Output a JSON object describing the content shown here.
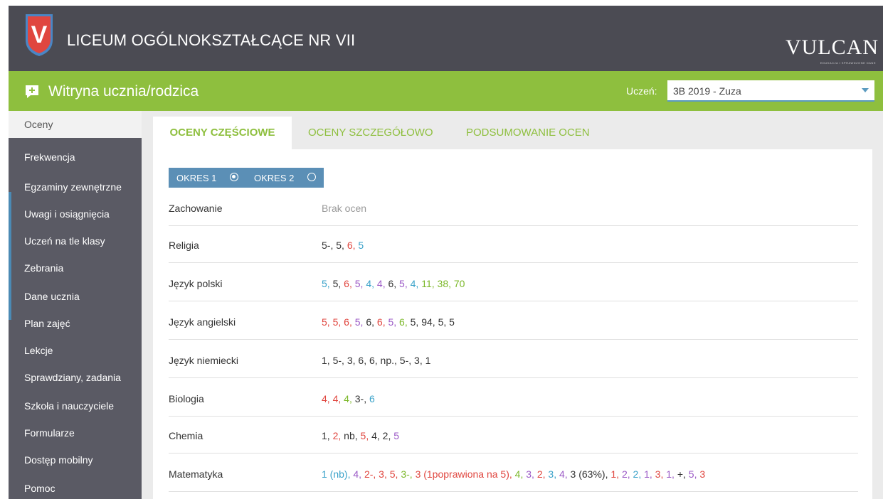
{
  "header": {
    "school_name": "LICEUM OGÓLNOKSZTAŁCĄCE NR VII",
    "brand": "VULCAN",
    "brand_sub": "EDUKACJA I SPRAWDZONE DANE",
    "logo_letter": "V",
    "colors": {
      "topbar": "#4b4b53",
      "greenbar": "#8ebf3e",
      "shield": "#e0463f",
      "accent": "#5b8fb6"
    }
  },
  "portal": {
    "title": "Witryna ucznia/rodzica",
    "icon": "chat-plus-icon",
    "student_label": "Uczeń:",
    "student_value": "3B  2019 - Zuza"
  },
  "sidebar": {
    "items": [
      {
        "label": "Oceny",
        "active": true
      },
      {
        "label": "Frekwencja"
      },
      {
        "label": "Egzaminy zewnętrzne"
      },
      {
        "label": "Uwagi i osiągnięcia"
      },
      {
        "label": "Uczeń na tle klasy"
      },
      {
        "label": "Zebrania"
      },
      {
        "label": "Dane ucznia"
      },
      {
        "label": "Plan zajęć"
      },
      {
        "label": "Lekcje"
      },
      {
        "label": "Sprawdziany, zadania"
      },
      {
        "label": "Szkoła i nauczyciele"
      },
      {
        "label": "Formularze"
      },
      {
        "label": "Dostęp mobilny"
      },
      {
        "label": "Pomoc"
      }
    ]
  },
  "tabs": [
    {
      "label": "OCENY CZĘŚCIOWE",
      "active": true
    },
    {
      "label": "OCENY SZCZEGÓŁOWO"
    },
    {
      "label": "PODSUMOWANIE OCEN"
    }
  ],
  "periods": [
    {
      "label": "OKRES 1",
      "selected": true
    },
    {
      "label": "OKRES 2",
      "selected": false
    }
  ],
  "subjects": [
    {
      "name": "Zachowanie",
      "grades": [
        {
          "v": "Brak ocen",
          "c": "gray"
        }
      ]
    },
    {
      "name": "Religia",
      "grades": [
        {
          "v": "5-",
          "c": "black"
        },
        {
          "v": "5",
          "c": "black"
        },
        {
          "v": "6",
          "c": "red"
        },
        {
          "v": "5",
          "c": "blue"
        }
      ]
    },
    {
      "name": "Język polski",
      "grades": [
        {
          "v": "5",
          "c": "blue"
        },
        {
          "v": "5",
          "c": "black"
        },
        {
          "v": "6",
          "c": "red"
        },
        {
          "v": "5",
          "c": "purple"
        },
        {
          "v": "4",
          "c": "blue"
        },
        {
          "v": "4",
          "c": "purple"
        },
        {
          "v": "6",
          "c": "black"
        },
        {
          "v": "5",
          "c": "purple"
        },
        {
          "v": "4",
          "c": "blue"
        },
        {
          "v": "11",
          "c": "green"
        },
        {
          "v": "38",
          "c": "green"
        },
        {
          "v": "70",
          "c": "green"
        }
      ]
    },
    {
      "name": "Język angielski",
      "grades": [
        {
          "v": "5",
          "c": "red"
        },
        {
          "v": "5",
          "c": "red"
        },
        {
          "v": "6",
          "c": "red"
        },
        {
          "v": "5",
          "c": "purple"
        },
        {
          "v": "6",
          "c": "black"
        },
        {
          "v": "6",
          "c": "red"
        },
        {
          "v": "5",
          "c": "purple"
        },
        {
          "v": "6",
          "c": "green"
        },
        {
          "v": "5",
          "c": "black"
        },
        {
          "v": "94",
          "c": "black"
        },
        {
          "v": "5",
          "c": "black"
        },
        {
          "v": "5",
          "c": "black"
        }
      ]
    },
    {
      "name": "Język niemiecki",
      "grades": [
        {
          "v": "1",
          "c": "black"
        },
        {
          "v": "5-",
          "c": "black"
        },
        {
          "v": "3",
          "c": "black"
        },
        {
          "v": "6",
          "c": "black"
        },
        {
          "v": "6",
          "c": "black"
        },
        {
          "v": "np.",
          "c": "black"
        },
        {
          "v": "5-",
          "c": "black"
        },
        {
          "v": "3",
          "c": "black"
        },
        {
          "v": "1",
          "c": "black"
        }
      ]
    },
    {
      "name": "Biologia",
      "grades": [
        {
          "v": "4",
          "c": "red"
        },
        {
          "v": "4",
          "c": "red"
        },
        {
          "v": "4",
          "c": "green"
        },
        {
          "v": "3-",
          "c": "black"
        },
        {
          "v": "6",
          "c": "blue"
        }
      ]
    },
    {
      "name": "Chemia",
      "grades": [
        {
          "v": "1",
          "c": "black"
        },
        {
          "v": "2",
          "c": "red"
        },
        {
          "v": "nb",
          "c": "black"
        },
        {
          "v": "5",
          "c": "red"
        },
        {
          "v": "4",
          "c": "black"
        },
        {
          "v": "2",
          "c": "black"
        },
        {
          "v": "5",
          "c": "purple"
        }
      ]
    },
    {
      "name": "Matematyka",
      "grades": [
        {
          "v": "1 (nb)",
          "c": "blue"
        },
        {
          "v": "4",
          "c": "purple"
        },
        {
          "v": "2-",
          "c": "red"
        },
        {
          "v": "3",
          "c": "red"
        },
        {
          "v": "5",
          "c": "red"
        },
        {
          "v": "3-",
          "c": "green"
        },
        {
          "v": "3 (1poprawiona na 5)",
          "c": "red"
        },
        {
          "v": "4",
          "c": "green"
        },
        {
          "v": "3",
          "c": "purple"
        },
        {
          "v": "2",
          "c": "red"
        },
        {
          "v": "3",
          "c": "blue"
        },
        {
          "v": "4",
          "c": "purple"
        },
        {
          "v": "3 (63%)",
          "c": "black"
        },
        {
          "v": "1",
          "c": "red"
        },
        {
          "v": "2",
          "c": "purple"
        },
        {
          "v": "2",
          "c": "blue"
        },
        {
          "v": "1",
          "c": "purple"
        },
        {
          "v": "3",
          "c": "red"
        },
        {
          "v": "1",
          "c": "purple"
        },
        {
          "v": "+",
          "c": "black"
        },
        {
          "v": "5",
          "c": "purple"
        },
        {
          "v": "3",
          "c": "red"
        }
      ]
    }
  ]
}
